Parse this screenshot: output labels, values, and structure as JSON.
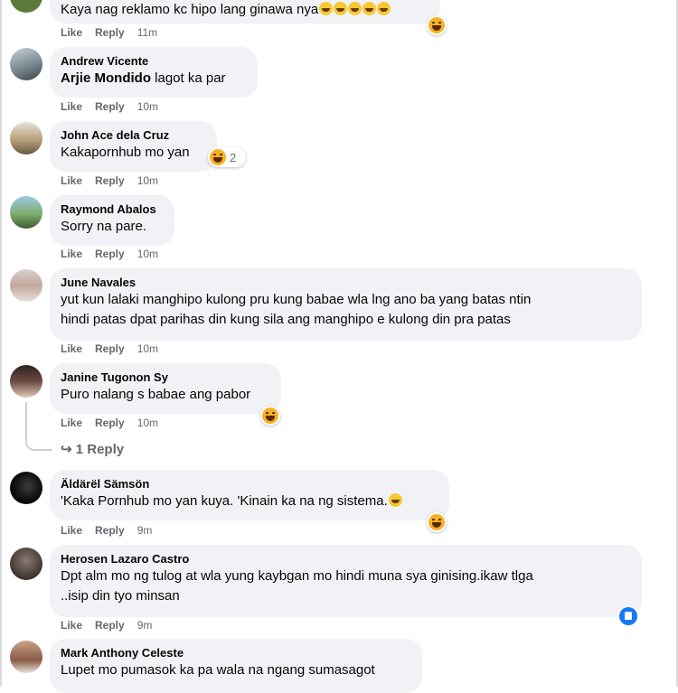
{
  "comments": [
    {
      "author": "",
      "text": "Kaya nag reklamo kc hipo lang ginawa nya",
      "like": "Like",
      "reply": "Reply",
      "time": "11m"
    },
    {
      "author": "Andrew Vicente",
      "mention": "Arjie Mondido",
      "text": " lagot ka par",
      "like": "Like",
      "reply": "Reply",
      "time": "10m"
    },
    {
      "author": "John Ace dela Cruz",
      "text": "Kakapornhub mo yan",
      "reaction_count": "2",
      "like": "Like",
      "reply": "Reply",
      "time": "10m"
    },
    {
      "author": "Raymond Abalos",
      "text": "Sorry na pare.",
      "like": "Like",
      "reply": "Reply",
      "time": "10m"
    },
    {
      "author": "June Navales",
      "text_line1": "yut kun lalaki manghipo kulong pru kung babae wla lng ano ba yang batas ntin",
      "text_line2": "hindi patas dpat parihas din kung sila ang manghipo e kulong din pra patas",
      "like": "Like",
      "reply": "Reply",
      "time": "10m"
    },
    {
      "author": "Janine Tugonon Sy",
      "text": "Puro nalang s babae ang pabor",
      "like": "Like",
      "reply": "Reply",
      "time": "10m",
      "replies_link": "1 Reply"
    },
    {
      "author": "Äldärël Sämsön",
      "text": "'Kaka Pornhub mo yan kuya. 'Kinain ka na ng sistema.",
      "like": "Like",
      "reply": "Reply",
      "time": "9m"
    },
    {
      "author": "Herosen Lazaro Castro",
      "text_line1": "Dpt alm mo ng tulog at wla yung kaybgan mo hindi muna sya ginising.ikaw tlga",
      "text_line2": "..isip din tyo minsan",
      "like": "Like",
      "reply": "Reply",
      "time": "9m"
    },
    {
      "author": "Mark Anthony Celeste",
      "text": "Lupet mo pumasok ka pa wala na ngang sumasagot"
    }
  ],
  "icons": {
    "reaction": "laugh-reaction-icon",
    "like": "like-reaction-icon",
    "reply_arrow": "reply-arrow-icon"
  },
  "colors": {
    "bubble": "#f0f2f5",
    "meta": "#65676b",
    "like_blue": "#1877f2",
    "laugh_yellow": "#f7b125"
  }
}
